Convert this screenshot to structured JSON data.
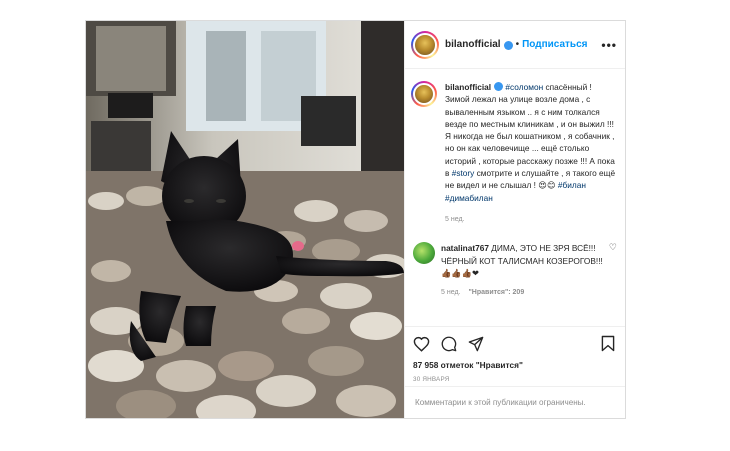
{
  "header": {
    "username": "bilanofficial",
    "separator": "•",
    "follow_label": "Подписаться",
    "more_label": "•••"
  },
  "caption": {
    "username": "bilanofficial",
    "tag_1": "#соломон",
    "text_1": " спасённый ! Зимой лежал на улице возле дома , с вываленным языком .. я с ним толкался везде по местным клиникам , и он выжил !!! Я никогда не был кошатником , я собачник , но он как человечище ... ещё столько историй , которые расскажу позже !!! А пока в ",
    "tag_2": "#story",
    "text_2": " смотрите и слушайте , я такого ещё не видел и не слышал ! 😍😊 ",
    "tag_3": "#билан",
    "text_3": " ",
    "tag_4": "#димабилан",
    "time": "5 нед."
  },
  "comment": {
    "username": "natalinat767",
    "text": " ДИМА, ЭТО НЕ ЗРЯ ВСЁ!!! ЧЁРНЫЙ КОТ ТАЛИСМАН КОЗЕРОГОВ!!! 👍🏾👍🏾👍🏾❤",
    "time": "5 нед.",
    "likes": "\"Нравится\": 209"
  },
  "actions": {
    "likes_text": "87 958 отметок \"Нравится\"",
    "date": "30 ЯНВАРЯ",
    "restricted_text": "Комментарии к этой публикации ограничены."
  },
  "icons": [
    "heart-icon",
    "comment-icon",
    "share-icon",
    "bookmark-icon",
    "verified-icon",
    "more-icon"
  ],
  "colors": {
    "link": "#00376b",
    "follow": "#0095f6",
    "muted": "#8e8e8e",
    "border": "#dbdbdb"
  }
}
